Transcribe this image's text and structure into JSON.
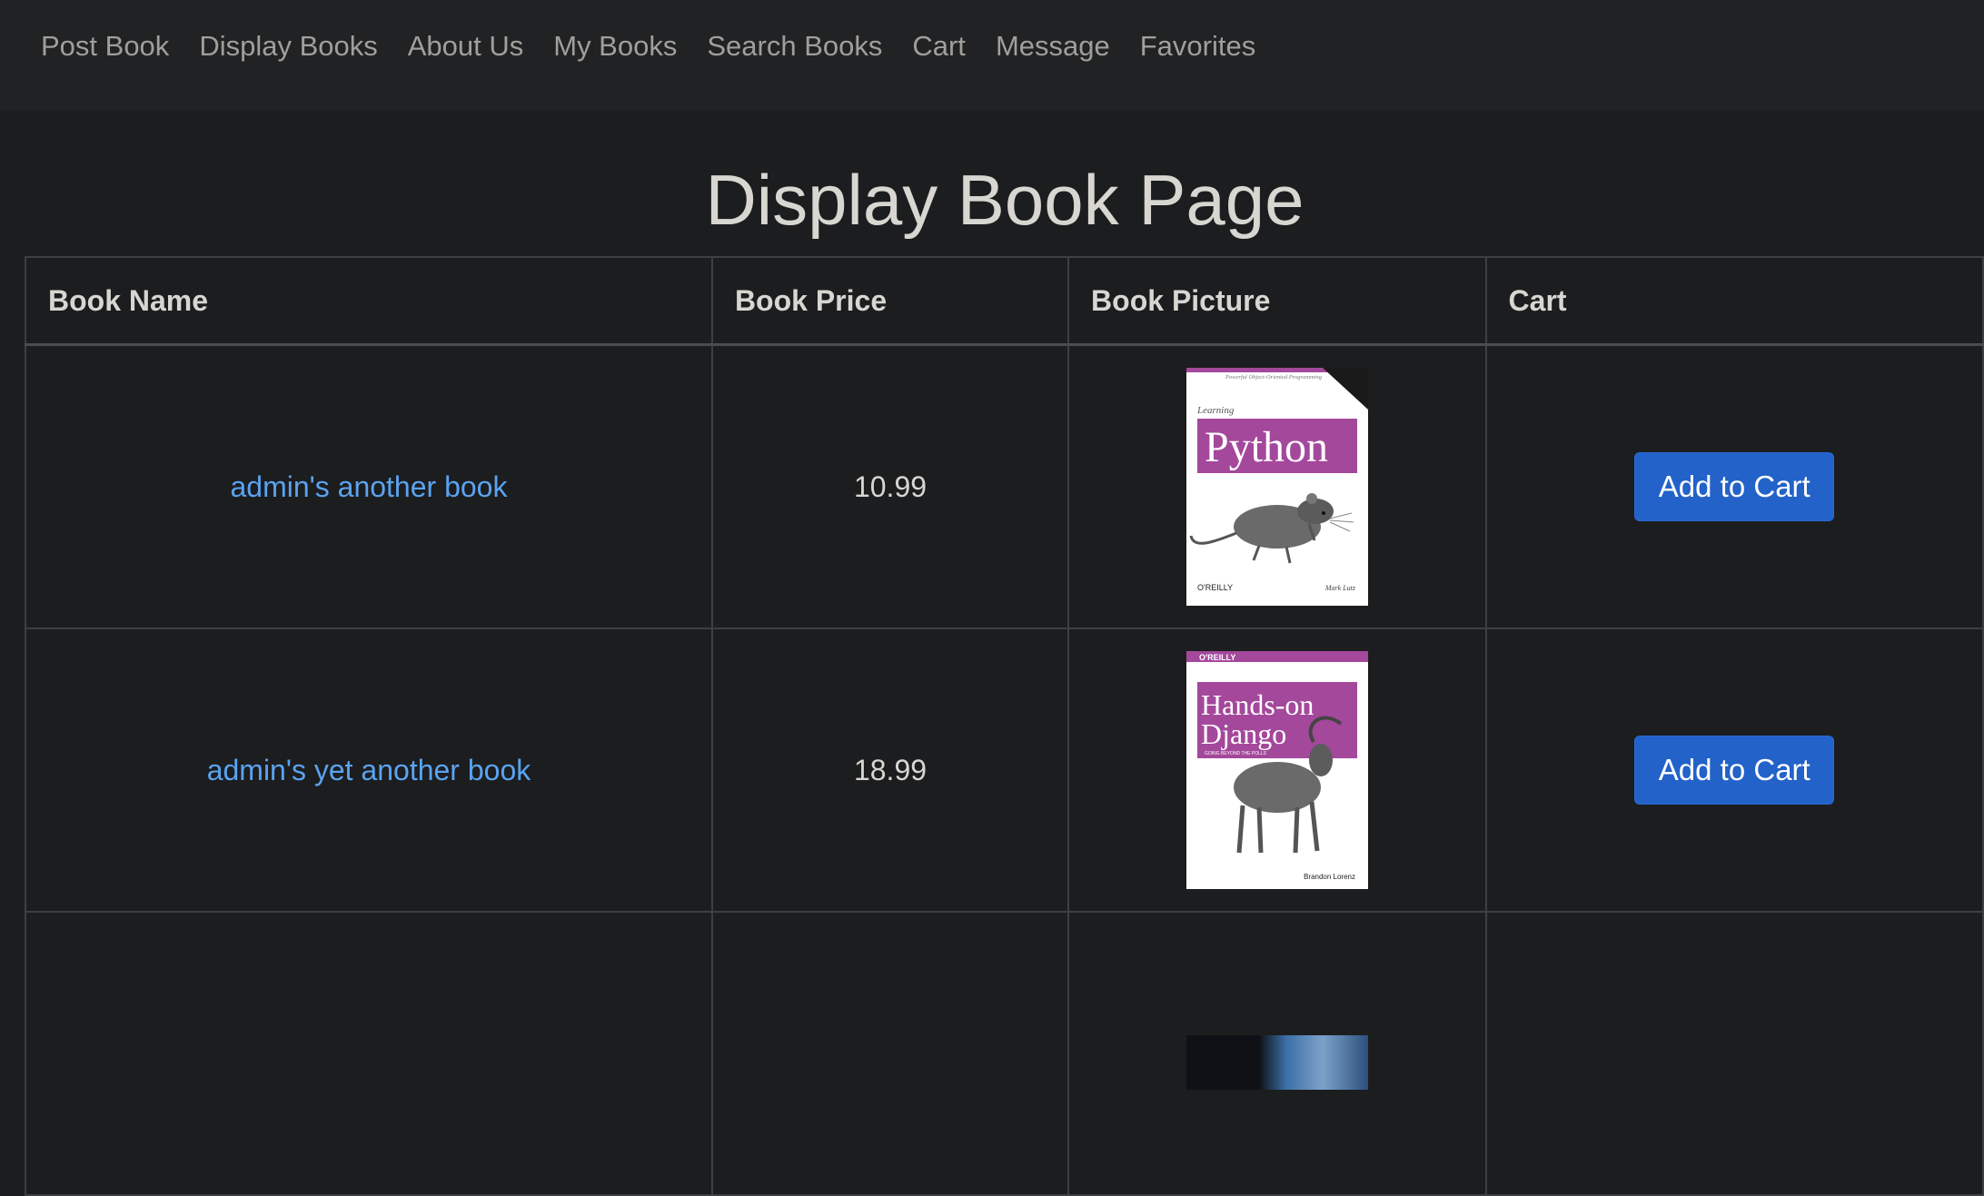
{
  "nav": {
    "items": [
      "Post Book",
      "Display Books",
      "About Us",
      "My Books",
      "Search Books",
      "Cart",
      "Message",
      "Favorites"
    ]
  },
  "page": {
    "title": "Display Book Page"
  },
  "table": {
    "headers": [
      "Book Name",
      "Book Price",
      "Book Picture",
      "Cart"
    ],
    "rows": [
      {
        "name": "admin's another book",
        "price": "10.99",
        "cover": {
          "top_line": "Powerful Object-Oriented Programming",
          "subtitle": "Learning",
          "title": "Python",
          "publisher": "O'REILLY",
          "author": "Mark Lutz",
          "accent": "#a4489c"
        },
        "button": "Add to Cart"
      },
      {
        "name": "admin's yet another book",
        "price": "18.99",
        "cover": {
          "publisher": "O'REILLY",
          "title_line1": "Hands-on",
          "title_line2": "Django",
          "tagline": "GOING BEYOND THE POLLS",
          "author": "Brandon Lorenz",
          "accent": "#a4489c"
        },
        "button": "Add to Cart"
      }
    ]
  },
  "colors": {
    "background": "#1c1d1f",
    "navbar": "#212223",
    "link": "#5aa3f0",
    "button": "#2262c9"
  }
}
